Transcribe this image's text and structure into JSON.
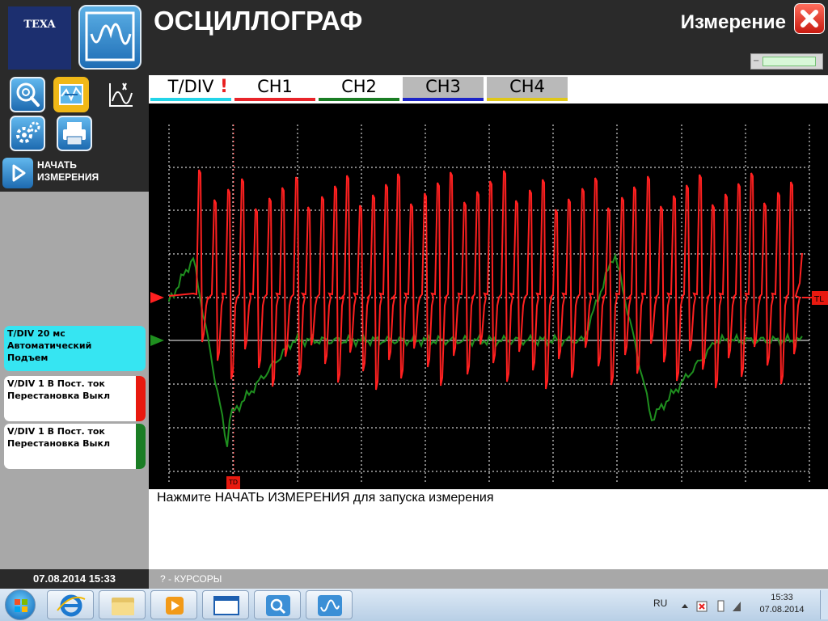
{
  "header": {
    "logo_text": "TEXA",
    "title": "ОСЦИЛЛОГРАФ",
    "mode_label": "Измерение",
    "close_icon": "close-icon",
    "level_slider_value": 0.82
  },
  "toolbar": {
    "row1": [
      {
        "name": "zoom-tool-button",
        "icon": "magnifier-icon",
        "active": false
      },
      {
        "name": "waveform-tool-button",
        "icon": "waveform-icon",
        "active": true
      },
      {
        "name": "measure-tool-button",
        "icon": "measure-chart-icon",
        "active": false
      }
    ],
    "row2": [
      {
        "name": "settings-button",
        "icon": "gear-icon"
      },
      {
        "name": "print-button",
        "icon": "printer-icon"
      }
    ]
  },
  "start_button": {
    "line1": "НАЧАТЬ",
    "line2": "ИЗМЕРЕНИЯ",
    "icon": "play-icon"
  },
  "tabs": [
    {
      "label": "T/DIV",
      "underline": "#22d4e8",
      "style": "white",
      "alert": "!"
    },
    {
      "label": "CH1",
      "underline": "#e8242a",
      "style": "white"
    },
    {
      "label": "CH2",
      "underline": "#1a7d24",
      "style": "white"
    },
    {
      "label": "CH3",
      "underline": "#1c24c8",
      "style": "gray"
    },
    {
      "label": "CH4",
      "underline": "#e0c818",
      "style": "gray"
    }
  ],
  "channel_cards": {
    "time": {
      "line1": "T/DIV  20 мс",
      "line2": "Автоматический",
      "line3": "Подъем",
      "color": "#36e5f2"
    },
    "ch1": {
      "line1": "V/DIV  1 В  Пост. ток",
      "line2": "Перестановка  Выкл",
      "color": "#e8190f"
    },
    "ch2": {
      "line1": "V/DIV  1 В  Пост. ток",
      "line2": "Перестановка  Выкл",
      "color": "#1a7d24"
    }
  },
  "scope": {
    "ch1_color": "#ff2020",
    "ch2_color": "#1f8f1f",
    "grid_color": "#ffffff",
    "trigger_level_label": "TL",
    "trigger_delay_label": "TD"
  },
  "message": "Нажмите НАЧАТЬ ИЗМЕРЕНИЯ для запуска измерения",
  "datetime": "07.08.2014  15:33",
  "status_text": "? - КУРСОРЫ",
  "taskbar": {
    "apps": [
      "ie-icon",
      "explorer-folder-icon",
      "media-player-icon",
      "window-icon",
      "texa-diagnostic-icon",
      "oscilloscope-app-icon"
    ],
    "lang": "RU",
    "tray_time": "15:33",
    "tray_date": "07.08.2014"
  }
}
